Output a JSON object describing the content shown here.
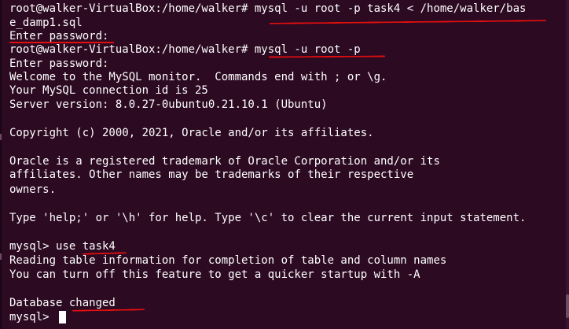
{
  "terminal": {
    "lines": [
      "root@walker-VirtualBox:/home/walker# mysql -u root -p task4 < /home/walker/bas",
      "e_damp1.sql",
      "Enter password:",
      "root@walker-VirtualBox:/home/walker# mysql -u root -p",
      "Enter password:",
      "Welcome to the MySQL monitor.  Commands end with ; or \\g.",
      "Your MySQL connection id is 25",
      "Server version: 8.0.27-0ubuntu0.21.10.1 (Ubuntu)",
      "",
      "Copyright (c) 2000, 2021, Oracle and/or its affiliates.",
      "",
      "Oracle is a registered trademark of Oracle Corporation and/or its",
      "affiliates. Other names may be trademarks of their respective",
      "owners.",
      "",
      "Type 'help;' or '\\h' for help. Type '\\c' to clear the current input statement.",
      "",
      "mysql> use task4",
      "Reading table information for completion of table and column names",
      "You can turn off this feature to get a quicker startup with -A",
      "",
      "Database changed",
      "mysql> "
    ]
  },
  "colors": {
    "background": "#2c0a22",
    "text": "#ffffff",
    "annotation": "#e30e0e"
  }
}
